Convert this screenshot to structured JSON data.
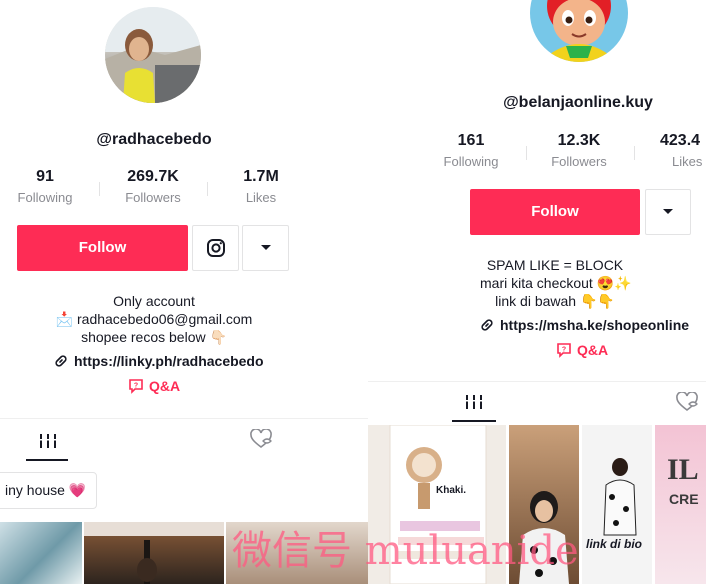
{
  "left_profile": {
    "username": "@radhacebedo",
    "stats": [
      {
        "value": "91",
        "label": "Following"
      },
      {
        "value": "269.7K",
        "label": "Followers"
      },
      {
        "value": "1.7M",
        "label": "Likes"
      }
    ],
    "follow_label": "Follow",
    "bio_lines": [
      "Only account",
      "📩 radhacebedo06@gmail.com",
      "shopee recos below 👇🏻"
    ],
    "link": "https://linky.ph/radhacebedo",
    "qa_label": "Q&A",
    "playlist_chip": "iny house 💗"
  },
  "right_profile": {
    "username": "@belanjaonline.kuy",
    "stats": [
      {
        "value": "161",
        "label": "Following"
      },
      {
        "value": "12.3K",
        "label": "Followers"
      },
      {
        "value": "423.4",
        "label": "Likes"
      }
    ],
    "follow_label": "Follow",
    "bio_lines": [
      "SPAM LIKE = BLOCK",
      "mari kita checkout 😍✨",
      "link di bawah 👇👇"
    ],
    "link": "https://msha.ke/shopeonline",
    "qa_label": "Q&A",
    "thumb_texts": [
      "Khaki.",
      "link di bio",
      "IL",
      "CRE"
    ]
  },
  "watermark": "微信号 muluanide",
  "colors": {
    "accent": "#fe2c55",
    "text": "#161823",
    "muted": "#8a8b91",
    "border": "#e3e3e4"
  },
  "icons": [
    "instagram-icon",
    "caret-down-icon",
    "link-icon",
    "qa-icon",
    "grid-icon",
    "liked-hidden-icon"
  ]
}
